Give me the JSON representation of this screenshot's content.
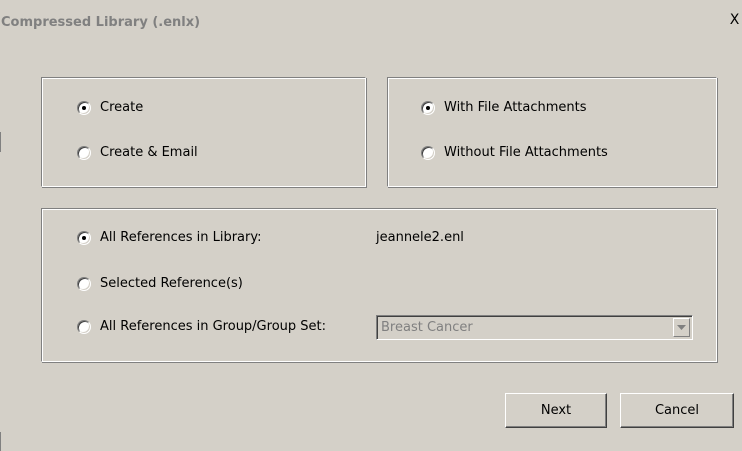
{
  "window": {
    "title": "Compressed Library (.enlx)",
    "close_glyph": "X"
  },
  "create_group": {
    "options": [
      {
        "label": "Create",
        "checked": true
      },
      {
        "label": "Create & Email",
        "checked": false
      }
    ]
  },
  "attachments_group": {
    "options": [
      {
        "label": "With File Attachments",
        "checked": true
      },
      {
        "label": "Without File Attachments",
        "checked": false
      }
    ]
  },
  "references_group": {
    "options": [
      {
        "label": "All References in Library:",
        "checked": true
      },
      {
        "label": "Selected Reference(s)",
        "checked": false
      },
      {
        "label": "All References in Group/Group Set:",
        "checked": false
      }
    ],
    "library_name": "jeannele2.enl",
    "group_select": {
      "value": "Breast Cancer",
      "disabled": true
    }
  },
  "buttons": {
    "next_label": "Next",
    "cancel_label": "Cancel"
  },
  "icons": {
    "close": "close-icon",
    "dropdown": "chevron-down-icon",
    "radio_checked": "radio-checked-icon",
    "radio_unchecked": "radio-unchecked-icon"
  }
}
